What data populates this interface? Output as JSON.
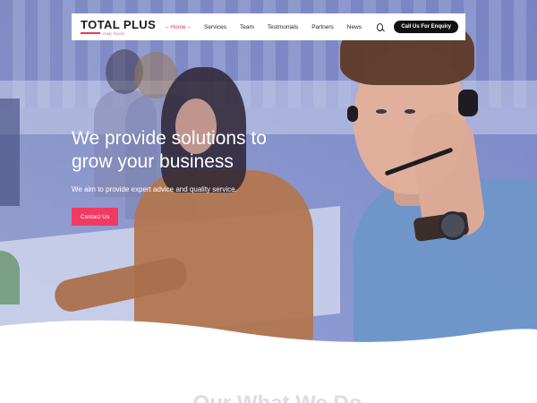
{
  "header": {
    "logo_text": "TOTAL PLUS",
    "logo_tagline": "ONE PAGE",
    "nav": [
      {
        "label": "Home",
        "active": true
      },
      {
        "label": "Services",
        "active": false
      },
      {
        "label": "Team",
        "active": false
      },
      {
        "label": "Testmonials",
        "active": false
      },
      {
        "label": "Partners",
        "active": false
      },
      {
        "label": "News",
        "active": false
      }
    ],
    "search_icon": "search-icon",
    "cta_label": "Call Us For Enquiry"
  },
  "hero": {
    "title": "We provide solutions to grow your business",
    "subtitle": "We aim to provide expert advice and quality service.",
    "button_label": "Contact Us"
  },
  "section": {
    "title": "Our What We Do"
  },
  "colors": {
    "accent": "#f03a64",
    "cta_bg": "#111111",
    "overlay": "#6b7bcf"
  }
}
